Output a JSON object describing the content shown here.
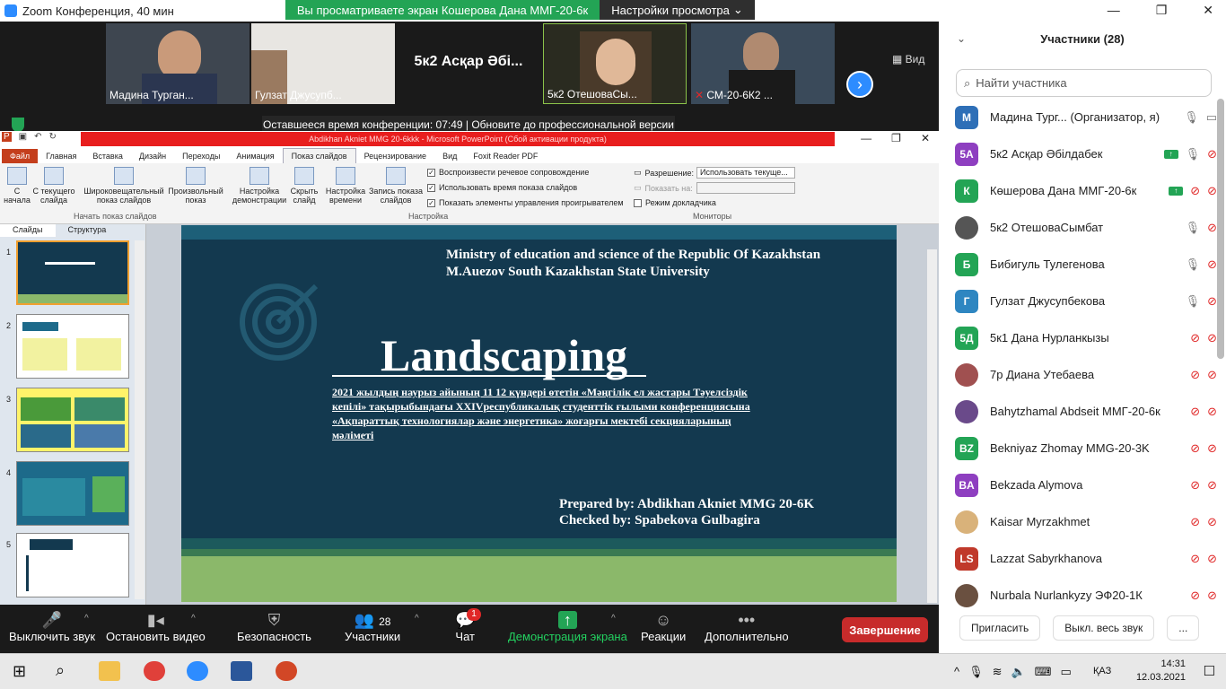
{
  "zoom": {
    "window_title": "Zoom Конференция, 40 мин",
    "share_banner": "Вы просматриваете экран Кошерова Дана ММГ-20-6к",
    "view_settings": "Настройки просмотра",
    "timer_text": "Оставшееся время конференции: 07:49 | Обновите до профессиональной версии",
    "view_label": "Вид",
    "videos": [
      {
        "name": "Мадина Турган..."
      },
      {
        "name": "Гулзат Джусупб..."
      },
      {
        "name": "5к2  Асқар Әбі..."
      },
      {
        "name": "5к2 ОтешоваСы..."
      },
      {
        "name": "СМ-20-6К2 ..."
      }
    ]
  },
  "ppt": {
    "title": "Abdikhan Akniet MMG 20-6kkk  -  Microsoft PowerPoint (Сбой активации продукта)",
    "tabs": [
      "Файл",
      "Главная",
      "Вставка",
      "Дизайн",
      "Переходы",
      "Анимация",
      "Показ слайдов",
      "Рецензирование",
      "Вид",
      "Foxit Reader PDF"
    ],
    "ribbon": {
      "b1": "С начала",
      "b2": "С текущего слайда",
      "b3": "Широковещательный показ слайдов",
      "b4": "Произвольный показ",
      "group1": "Начать показ слайдов",
      "b5": "Настройка демонстрации",
      "b6": "Скрыть слайд",
      "b7": "Настройка времени",
      "b8": "Запись показа слайдов",
      "chk1": "Воспроизвести речевое сопровождение",
      "chk2": "Использовать время показа слайдов",
      "chk3": "Показать элементы управления проигрывателем",
      "group2": "Настройка",
      "res_label": "Разрешение:",
      "res_value": "Использовать текуще...",
      "showon_label": "Показать на:",
      "presenter": "Режим докладчика",
      "group3": "Мониторы"
    },
    "pane_tabs": [
      "Слайды",
      "Структура"
    ],
    "slide_numbers": [
      "1",
      "2",
      "3",
      "4",
      "5"
    ],
    "slide": {
      "ministry": "Ministry of education and science of the Republic Of Kazakhstan M.Auezov South Kazakhstan State University",
      "title": "Landscaping",
      "subtitle": "2021 жылдың наурыз  айының 11 12 күндері өтетін «Мәңгілік ел жастары Тәуелсіздік кепілі» тақырыбындағы  XXIVреспубликалық  студенттік ғылыми конференциясына «Ақпараттық  технологиялар және энергетика» жоғарғы мектебі секцияларының мәліметі",
      "prepared": "Prepared by: Abdikhan Akniet MMG  20-6K",
      "checked": "Checked by: Spabekova Gulbagira"
    }
  },
  "toolbar": {
    "mute": "Выключить звук",
    "video": "Остановить видео",
    "security": "Безопасность",
    "participants": "Участники",
    "participants_count": "28",
    "chat": "Чат",
    "chat_badge": "1",
    "share": "Демонстрация экрана",
    "reactions": "Реакции",
    "more": "Дополнительно",
    "end": "Завершение"
  },
  "panel": {
    "title": "Участники (28)",
    "search_placeholder": "Найти участника",
    "participants": [
      {
        "initials": "М",
        "name": "Мадина Тург...  (Организатор, я)",
        "color": "#2e6fb7"
      },
      {
        "initials": "5A",
        "name": "5к2  Асқар Әбілдабек",
        "color": "#8e3fc0"
      },
      {
        "initials": "К",
        "name": "Көшерова Дана ММГ-20-6к",
        "color": "#23a455"
      },
      {
        "initials": "",
        "name": "5к2 ОтешоваСымбат",
        "color": "#555555"
      },
      {
        "initials": "Б",
        "name": "Бибигуль Тулегенова",
        "color": "#23a455"
      },
      {
        "initials": "Г",
        "name": "Гулзат Джусупбекова",
        "color": "#2e86c1"
      },
      {
        "initials": "5Д",
        "name": "5к1 Дана Нурланкызы",
        "color": "#23a455"
      },
      {
        "initials": "",
        "name": "7р Диана Утебаева",
        "color": "#a05050"
      },
      {
        "initials": "",
        "name": "Bahytzhamal Abdseit ММГ-20-6к",
        "color": "#6a4a8a"
      },
      {
        "initials": "BZ",
        "name": "Bekniyaz Zhomay MMG-20-3K",
        "color": "#23a455"
      },
      {
        "initials": "BA",
        "name": "Bekzada Alymova",
        "color": "#8e3fc0"
      },
      {
        "initials": "",
        "name": "Kaisar Myrzakhmet",
        "color": "#d9b27a"
      },
      {
        "initials": "LS",
        "name": "Lazzat Sabyrkhanova",
        "color": "#c0392b"
      },
      {
        "initials": "",
        "name": "Nurbala Nurlankyzy ЭФ20-1К",
        "color": "#6a5040"
      }
    ],
    "invite": "Пригласить",
    "mute_all": "Выкл. весь звук",
    "more": "..."
  },
  "taskbar": {
    "lang": "ҚАЗ",
    "time": "14:31",
    "date": "12.03.2021"
  }
}
